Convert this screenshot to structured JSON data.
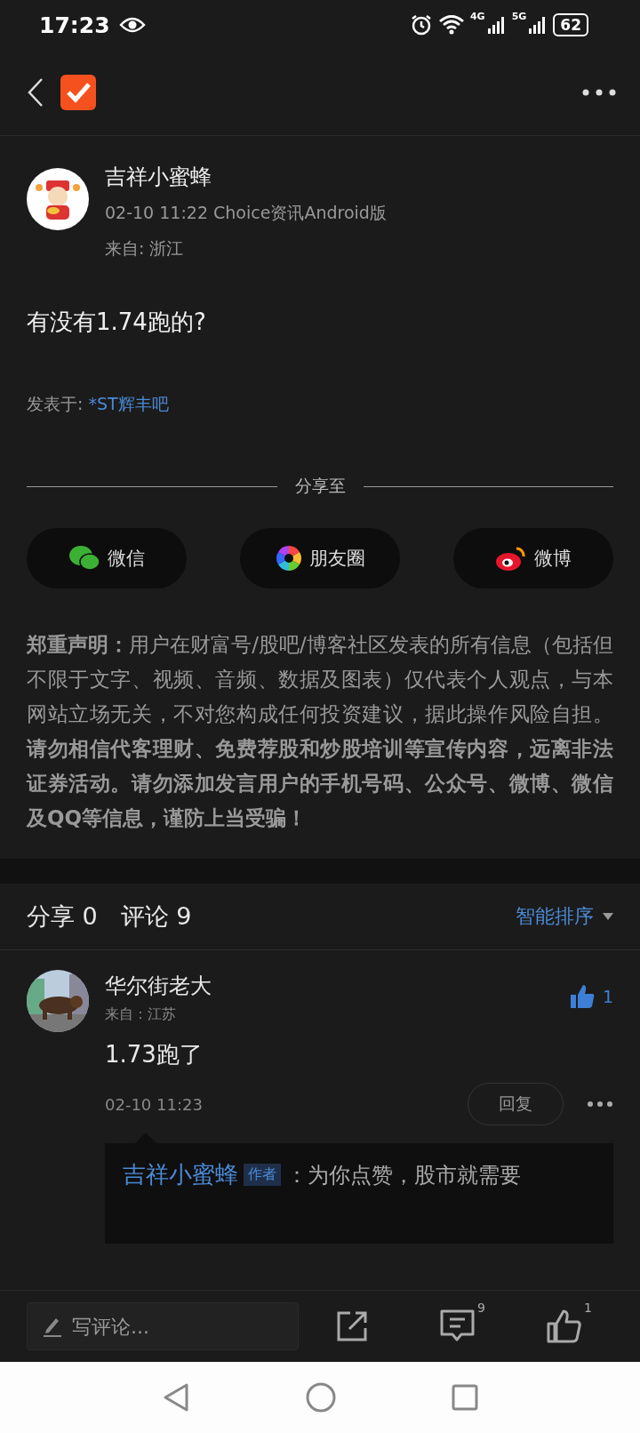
{
  "status_bar": {
    "time": "17:23",
    "network_1": "4G",
    "network_2": "5G",
    "battery": "62"
  },
  "post": {
    "author": "吉祥小蜜蜂",
    "meta": "02-10 11:22 Choice资讯Android版",
    "location": "来自: 浙江",
    "title": "有没有1.74跑的?",
    "posted_in_label": "发表于:",
    "posted_in": "*ST辉丰吧"
  },
  "share": {
    "heading": "分享至",
    "targets": [
      {
        "kind": "wechat",
        "label": "微信"
      },
      {
        "kind": "moments",
        "label": "朋友圈"
      },
      {
        "kind": "weibo",
        "label": "微博"
      }
    ]
  },
  "disclaimer": "**郑重声明：**用户在财富号/股吧/博客社区发表的所有信息（包括但不限于文字、视频、音频、数据及图表）仅代表个人观点，与本网站立场无关，不对您构成任何投资建议，据此操作风险自担。**请勿相信代客理财、免费荐股和炒股培训等宣传内容，远离非法证券活动。请勿添加发言用户的手机号码、公众号、微博、微信及QQ等信息，谨防上当受骗！**",
  "comments_header": {
    "shares": "分享 0",
    "comments": "评论 9",
    "sort": "智能排序"
  },
  "comments": [
    {
      "author": "华尔街老大",
      "location": "来自：江苏",
      "likes": "1",
      "liked": true,
      "text": "1.73跑了",
      "time": "02-10 11:23",
      "reply_button": "回复",
      "replies": [
        {
          "author": "吉祥小蜜蜂",
          "badge": "作者",
          "text": "：为你点赞，股市就需要"
        }
      ]
    }
  ],
  "bottom_bar": {
    "placeholder": "写评论...",
    "comment_count": "9",
    "like_count": "1"
  }
}
